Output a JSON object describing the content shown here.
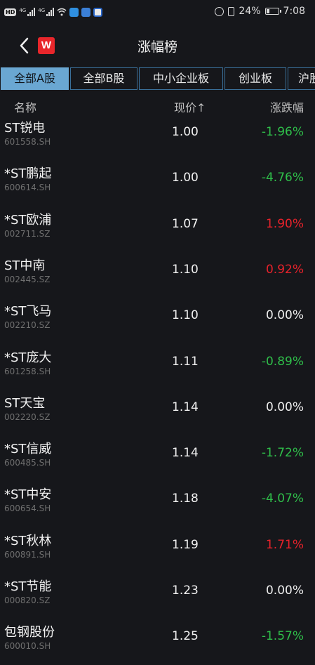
{
  "status_bar": {
    "network_badge": "HD",
    "signal1_label": "4G",
    "signal2_label": "4G",
    "battery_percent": "24%",
    "time": "7:08",
    "battery_level": 0.24
  },
  "header": {
    "title": "涨幅榜",
    "logo_letter": "W",
    "back_icon": "chevron-left-icon"
  },
  "tabs": [
    {
      "label": "全部A股",
      "active": true
    },
    {
      "label": "全部B股",
      "active": false
    },
    {
      "label": "中小企业板",
      "active": false
    },
    {
      "label": "创业板",
      "active": false
    },
    {
      "label": "沪股",
      "active": false
    }
  ],
  "columns": {
    "name": "名称",
    "price": "现价↑",
    "change": "涨跌幅"
  },
  "colors": {
    "up": "#e8222b",
    "down": "#2fbf4a",
    "flat": "#eeeeee",
    "tab_active": "#6aa7d2"
  },
  "rows": [
    {
      "name": "ST锐电",
      "code": "601558.SH",
      "price": "1.00",
      "change": "-1.96%",
      "dir": "down"
    },
    {
      "name": "*ST鹏起",
      "code": "600614.SH",
      "price": "1.00",
      "change": "-4.76%",
      "dir": "down"
    },
    {
      "name": "*ST欧浦",
      "code": "002711.SZ",
      "price": "1.07",
      "change": "1.90%",
      "dir": "up"
    },
    {
      "name": "ST中南",
      "code": "002445.SZ",
      "price": "1.10",
      "change": "0.92%",
      "dir": "up"
    },
    {
      "name": "*ST飞马",
      "code": "002210.SZ",
      "price": "1.10",
      "change": "0.00%",
      "dir": "flat"
    },
    {
      "name": "*ST庞大",
      "code": "601258.SH",
      "price": "1.11",
      "change": "-0.89%",
      "dir": "down"
    },
    {
      "name": "ST天宝",
      "code": "002220.SZ",
      "price": "1.14",
      "change": "0.00%",
      "dir": "flat"
    },
    {
      "name": "*ST信威",
      "code": "600485.SH",
      "price": "1.14",
      "change": "-1.72%",
      "dir": "down"
    },
    {
      "name": "*ST中安",
      "code": "600654.SH",
      "price": "1.18",
      "change": "-4.07%",
      "dir": "down"
    },
    {
      "name": "*ST秋林",
      "code": "600891.SH",
      "price": "1.19",
      "change": "1.71%",
      "dir": "up"
    },
    {
      "name": "*ST节能",
      "code": "000820.SZ",
      "price": "1.23",
      "change": "0.00%",
      "dir": "flat"
    },
    {
      "name": "包钢股份",
      "code": "600010.SH",
      "price": "1.25",
      "change": "-1.57%",
      "dir": "down"
    }
  ]
}
